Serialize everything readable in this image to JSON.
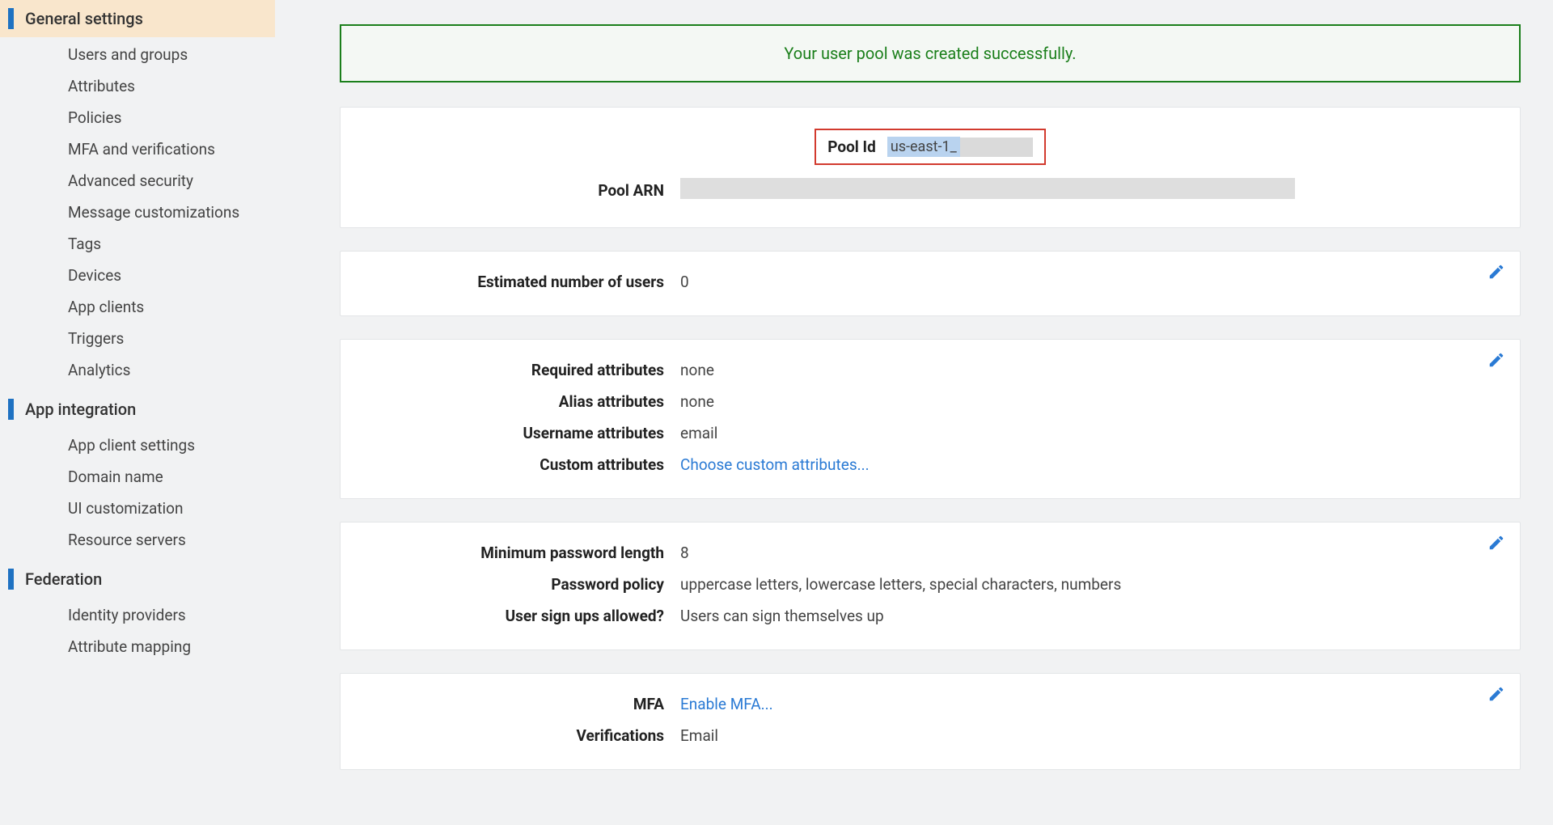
{
  "sidebar": {
    "sections": [
      {
        "label": "General settings",
        "active": true,
        "items": [
          "Users and groups",
          "Attributes",
          "Policies",
          "MFA and verifications",
          "Advanced security",
          "Message customizations",
          "Tags",
          "Devices",
          "App clients",
          "Triggers",
          "Analytics"
        ]
      },
      {
        "label": "App integration",
        "active": false,
        "items": [
          "App client settings",
          "Domain name",
          "UI customization",
          "Resource servers"
        ]
      },
      {
        "label": "Federation",
        "active": false,
        "items": [
          "Identity providers",
          "Attribute mapping"
        ]
      }
    ]
  },
  "alert": {
    "message": "Your user pool was created successfully."
  },
  "pool": {
    "id_label": "Pool Id",
    "id_value": "us-east-1_",
    "arn_label": "Pool ARN"
  },
  "users": {
    "estimated_label": "Estimated number of users",
    "estimated_value": "0"
  },
  "attributes": {
    "required_label": "Required attributes",
    "required_value": "none",
    "alias_label": "Alias attributes",
    "alias_value": "none",
    "username_label": "Username attributes",
    "username_value": "email",
    "custom_label": "Custom attributes",
    "custom_link": "Choose custom attributes..."
  },
  "password": {
    "minlen_label": "Minimum password length",
    "minlen_value": "8",
    "policy_label": "Password policy",
    "policy_value": "uppercase letters, lowercase letters, special characters, numbers",
    "signup_label": "User sign ups allowed?",
    "signup_value": "Users can sign themselves up"
  },
  "mfa": {
    "mfa_label": "MFA",
    "mfa_link": "Enable MFA...",
    "verifications_label": "Verifications",
    "verifications_value": "Email"
  }
}
